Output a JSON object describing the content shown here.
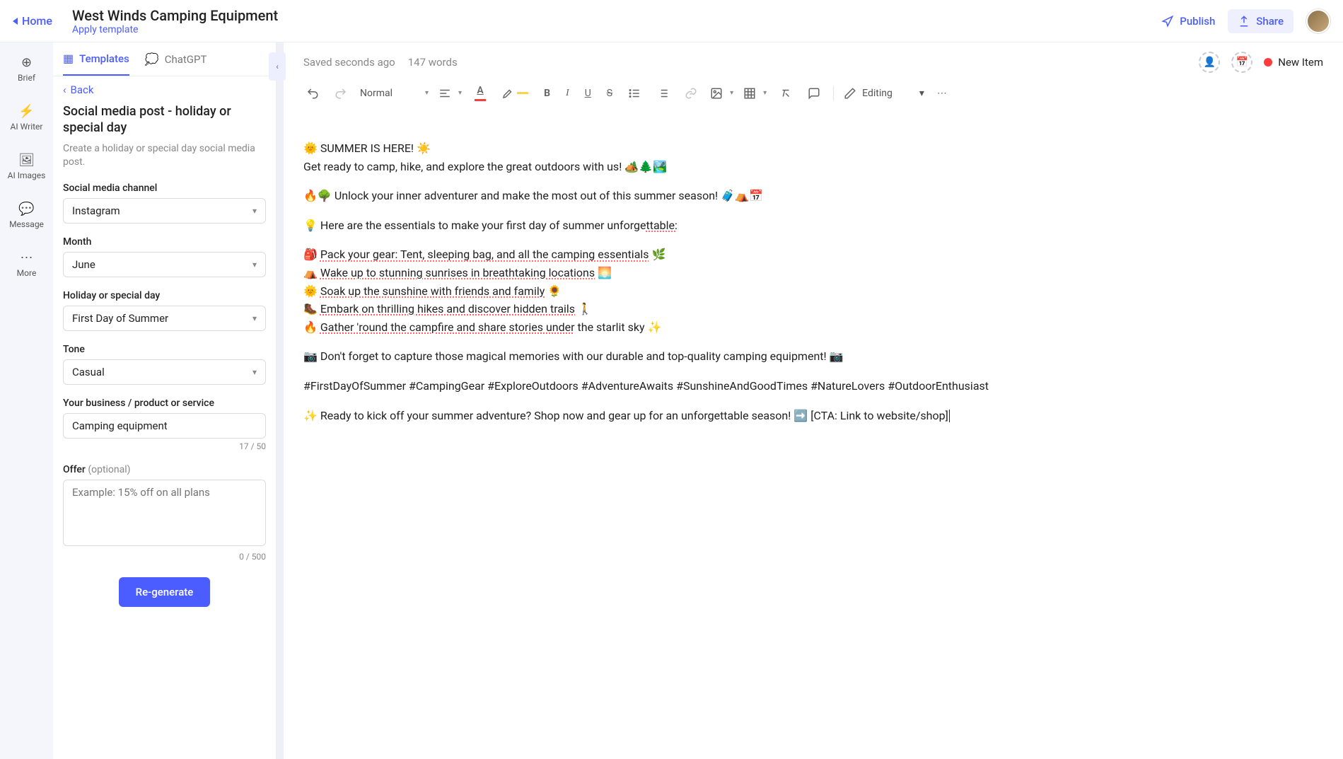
{
  "header": {
    "home": "Home",
    "doc_title": "West Winds Camping Equipment",
    "apply_template": "Apply template",
    "publish": "Publish",
    "share": "Share"
  },
  "rail": {
    "brief": "Brief",
    "ai_writer": "AI Writer",
    "ai_images": "AI Images",
    "message": "Message",
    "more": "More"
  },
  "tabs": {
    "templates": "Templates",
    "chatgpt": "ChatGPT"
  },
  "back": "Back",
  "form": {
    "title": "Social media post - holiday or special day",
    "desc": "Create a holiday or special day social media post.",
    "channel_label": "Social media channel",
    "channel_value": "Instagram",
    "month_label": "Month",
    "month_value": "June",
    "holiday_label": "Holiday or special day",
    "holiday_value": "First Day of Summer",
    "tone_label": "Tone",
    "tone_value": "Casual",
    "business_label": "Your business / product or service",
    "business_value": "Camping equipment",
    "business_count": "17 / 50",
    "offer_label": "Offer",
    "offer_optional": "(optional)",
    "offer_placeholder": "Example: 15% off on all plans",
    "offer_count": "0 / 500",
    "regen": "Re-generate"
  },
  "editor": {
    "saved": "Saved seconds ago",
    "wordcount": "147 words",
    "new_item": "New Item",
    "style_normal": "Normal",
    "editing_label": "Editing"
  },
  "content": {
    "p1a": "🌞 SUMMER IS HERE! ☀️",
    "p1b": "Get ready to camp, hike, and explore the great outdoors with us! 🏕️🌲🏞️",
    "p2": "🔥🌳 Unlock your inner adventurer and make the most out of this summer season! 🧳⛺📅",
    "p3a": "💡 Here are the essentials to make your first day of summer unforge",
    "p3b": "ttable:",
    "l1a": "🎒 ",
    "l1b": "Pack your gear: Tent, sleeping bag, and all the camping essentials",
    "l1c": " 🌿",
    "l2a": "⛺ ",
    "l2b": "Wake up to stunning sunrises in breathtaking locations",
    "l2c": " 🌅",
    "l3a": "🌞 ",
    "l3b": "Soak up the sunshine with friends and family",
    "l3c": " 🌻",
    "l4a": "🥾 ",
    "l4b": "Embark on thrilling hikes and discover hidden trails",
    "l4c": " 🚶",
    "l5a": "🔥 ",
    "l5b": "Gather 'round the campfire and share stories under",
    "l5c": " the starlit sky ✨",
    "p4": "📷 Don't forget to capture those magical memories with our durable and top-quality camping equipment! 📷",
    "p5": "#FirstDayOfSummer #CampingGear #ExploreOutdoors #AdventureAwaits #SunshineAndGoodTimes #NatureLovers #OutdoorEnthusiast",
    "p6": "✨ Ready to kick off your summer adventure? Shop now and gear up for an unforgettable season! ➡️ [CTA: Link to website/shop]"
  }
}
